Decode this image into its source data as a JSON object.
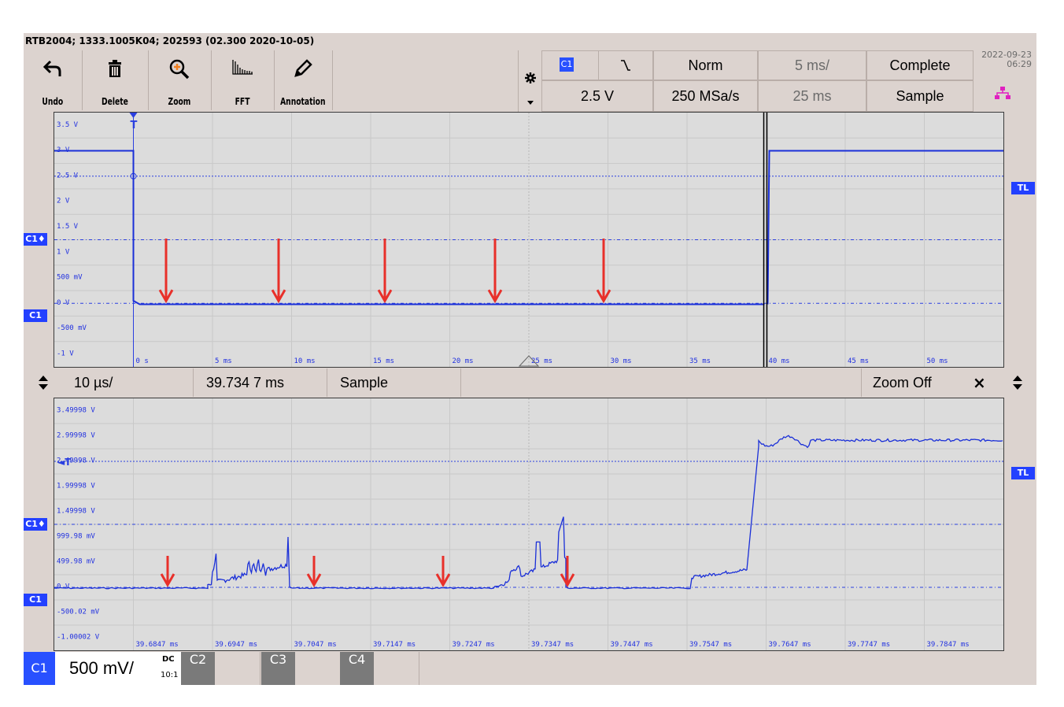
{
  "title_bar": "RTB2004; 1333.1005K04; 202593 (02.300 2020-10-05)",
  "toolbar": {
    "undo": "Undo",
    "delete": "Delete",
    "zoom": "Zoom",
    "fft": "FFT",
    "annotation": "Annotation"
  },
  "trigger": {
    "source": "C1",
    "slope_icon": "falling-edge-icon",
    "mode": "Norm",
    "level": "2.5 V",
    "sample_rate": "250 MSa/s",
    "timebase": "5 ms/",
    "position": "25 ms",
    "acq_status": "Complete",
    "acq_mode": "Sample",
    "date": "2022-09-23",
    "time": "06:29"
  },
  "main_plot": {
    "y_labels": [
      "3.5 V",
      "3 V",
      "2.5 V",
      "2 V",
      "1.5 V",
      "1 V",
      "500 mV",
      "0 V",
      "-500 mV",
      "-1 V"
    ],
    "x_labels": [
      "0 s",
      "5 ms",
      "10 ms",
      "15 ms",
      "20 ms",
      "25 ms",
      "30 ms",
      "35 ms",
      "40 ms",
      "45 ms",
      "50 ms"
    ],
    "trigger_marker": "T",
    "tl_marker": "TL",
    "c1_offset_marker": "C1♦",
    "c1_ground_marker": "C1"
  },
  "zoom_bar": {
    "timebase": "10 µs/",
    "position": "39.734 7 ms",
    "mode": "Sample",
    "zoom_off": "Zoom Off",
    "close": "×"
  },
  "zoom_plot": {
    "y_labels": [
      "3.49998 V",
      "2.99998 V",
      "2.49998 V",
      "1.99998 V",
      "1.49998 V",
      "999.98 mV",
      "499.98 mV",
      "0 V",
      "-500.02 mV",
      "-1.00002 V"
    ],
    "x_labels": [
      "39.6847 ms",
      "39.6947 ms",
      "39.7047 ms",
      "39.7147 ms",
      "39.7247 ms",
      "39.7347 ms",
      "39.7447 ms",
      "39.7547 ms",
      "39.7647 ms",
      "39.7747 ms",
      "39.7847 ms"
    ],
    "tl_marker": "TL",
    "c1_offset_marker": "C1♦",
    "c1_ground_marker": "C1"
  },
  "footer": {
    "ch1": "C1",
    "ch1_scale": "500 mV/",
    "ch1_coupling": "DC",
    "ch1_probe": "10:1",
    "ch2": "C2",
    "ch3": "C3",
    "ch4": "C4"
  },
  "colors": {
    "trace": "#1a2fd8",
    "arrow": "#e8302a",
    "channel": "#2850ff"
  }
}
